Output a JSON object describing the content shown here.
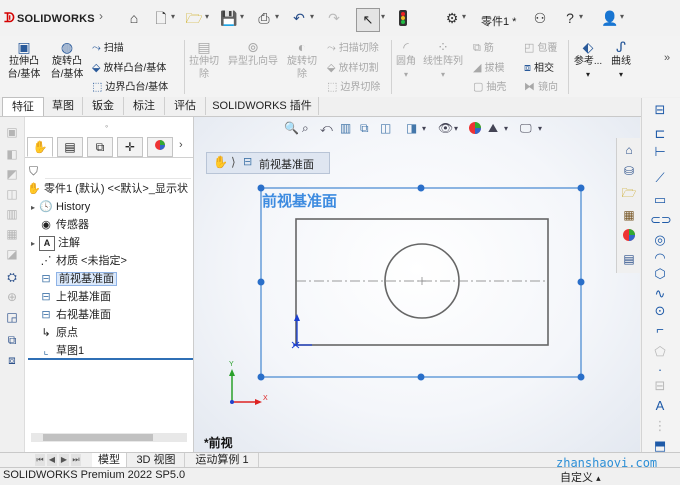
{
  "app": {
    "logo_text": "SOLIDWORKS",
    "doc_name": "零件1 *"
  },
  "quick_access": {
    "icons": [
      "home-icon",
      "new-document-icon",
      "open-icon",
      "save-icon",
      "print-icon",
      "undo-icon",
      "redo-icon",
      "select-cursor-icon",
      "rebuild-traffic-light-icon",
      "options-gear-icon"
    ],
    "right_icons": [
      "search-commands-icon",
      "help-icon",
      "user-icon"
    ]
  },
  "command_manager": {
    "features": [
      {
        "label": "拉伸凸台/基体",
        "icon": "extrude-boss-icon",
        "enabled": true
      },
      {
        "label": "旋转凸台/基体",
        "icon": "revolve-boss-icon",
        "enabled": true
      }
    ],
    "features_small": [
      {
        "label": "扫描",
        "icon": "sweep-icon",
        "enabled": true
      },
      {
        "label": "放样凸台/基体",
        "icon": "loft-icon",
        "enabled": true
      },
      {
        "label": "边界凸台/基体",
        "icon": "boundary-boss-icon",
        "enabled": true
      }
    ],
    "cut_large": [
      {
        "label": "拉伸切除",
        "icon": "extrude-cut-icon",
        "enabled": false
      },
      {
        "label": "异型孔向导",
        "icon": "hole-wizard-icon",
        "enabled": false
      },
      {
        "label": "旋转切除",
        "icon": "revolve-cut-icon",
        "enabled": false
      }
    ],
    "cut_small": [
      {
        "label": "扫描切除",
        "icon": "swept-cut-icon",
        "enabled": false
      },
      {
        "label": "放样切割",
        "icon": "lofted-cut-icon",
        "enabled": false
      },
      {
        "label": "边界切除",
        "icon": "boundary-cut-icon",
        "enabled": false
      }
    ],
    "fillet_group": [
      {
        "label": "圆角",
        "icon": "fillet-icon",
        "enabled": false
      },
      {
        "label": "线性阵列",
        "icon": "linear-pattern-icon",
        "enabled": false
      }
    ],
    "misc_small": [
      {
        "label": "筋",
        "icon": "rib-icon",
        "enabled": false
      },
      {
        "label": "拔模",
        "icon": "draft-icon",
        "enabled": false
      },
      {
        "label": "抽壳",
        "icon": "shell-icon",
        "enabled": false
      },
      {
        "label": "包覆",
        "icon": "wrap-icon",
        "enabled": false
      },
      {
        "label": "相交",
        "icon": "intersect-icon",
        "enabled": true
      },
      {
        "label": "镜向",
        "icon": "mirror-icon",
        "enabled": false
      }
    ],
    "reference": [
      {
        "label": "参考...",
        "icon": "reference-geometry-icon",
        "enabled": true
      },
      {
        "label": "曲线",
        "icon": "curves-icon",
        "enabled": true
      }
    ]
  },
  "tabs": [
    {
      "label": "特征",
      "active": true
    },
    {
      "label": "草图",
      "active": false
    },
    {
      "label": "钣金",
      "active": false
    },
    {
      "label": "标注",
      "active": false
    },
    {
      "label": "评估",
      "active": false
    },
    {
      "label": "SOLIDWORKS 插件",
      "active": false
    }
  ],
  "feature_tree": {
    "root": "零件1 (默认) <<默认>_显示状",
    "items": [
      {
        "label": "History",
        "icon": "history-icon",
        "expandable": true,
        "selected": false
      },
      {
        "label": "传感器",
        "icon": "sensor-icon",
        "expandable": false,
        "selected": false
      },
      {
        "label": "注解",
        "icon": "annotation-icon",
        "expandable": true,
        "selected": false
      },
      {
        "label": "材质 <未指定>",
        "icon": "material-icon",
        "expandable": false,
        "selected": false
      },
      {
        "label": "前视基准面",
        "icon": "plane-icon",
        "expandable": false,
        "selected": true
      },
      {
        "label": "上视基准面",
        "icon": "plane-icon",
        "expandable": false,
        "selected": false
      },
      {
        "label": "右视基准面",
        "icon": "plane-icon",
        "expandable": false,
        "selected": false
      },
      {
        "label": "原点",
        "icon": "origin-icon",
        "expandable": false,
        "selected": false
      },
      {
        "label": "草图1",
        "icon": "sketch-icon",
        "expandable": false,
        "selected": false
      }
    ]
  },
  "graphics": {
    "breadcrumb_label": "前视基准面",
    "plane_label": "前视基准面",
    "view_name": "*前视",
    "triad": {
      "x": "X",
      "y": "Y"
    },
    "accent": "#1e6fc8"
  },
  "bottom_tabs": [
    {
      "label": "模型",
      "active": true
    },
    {
      "label": "3D 视图",
      "active": false
    },
    {
      "label": "运动算例 1",
      "active": false
    }
  ],
  "status": {
    "text": "SOLIDWORKS Premium 2022 SP5.0",
    "custom": "自定义"
  },
  "watermark": "zhanshaoyi.com"
}
